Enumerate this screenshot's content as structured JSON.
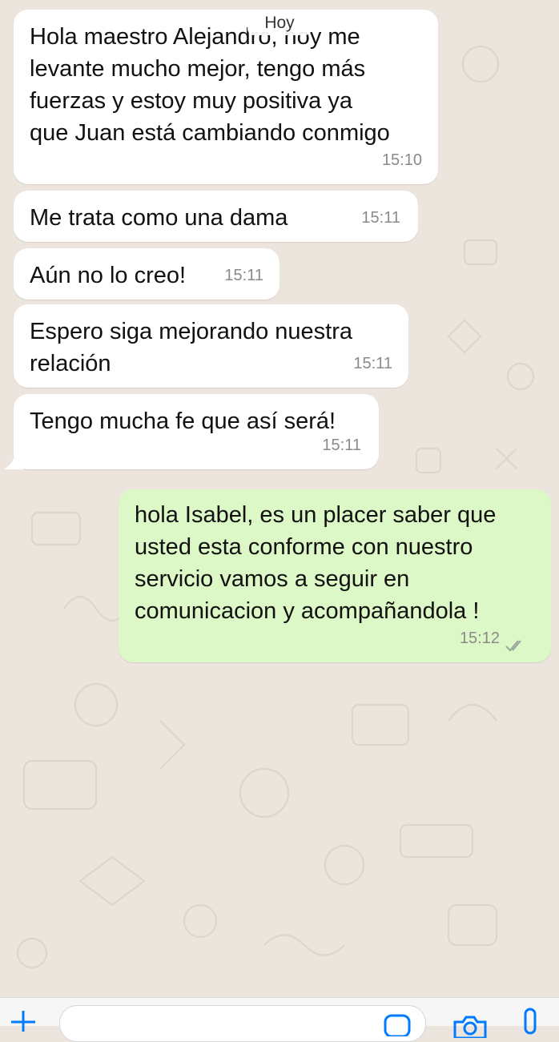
{
  "date_chip": "Hoy",
  "messages": [
    {
      "direction": "incoming",
      "text": "Hola maestro Alejandro, hoy me\nlevante mucho mejor, tengo más\nfuerzas y estoy muy positiva ya\nque Juan está cambiando conmigo",
      "time": "15:10"
    },
    {
      "direction": "incoming",
      "text": "Me trata como una dama",
      "time": "15:11"
    },
    {
      "direction": "incoming",
      "text": "Aún no lo creo!",
      "time": "15:11"
    },
    {
      "direction": "incoming",
      "text": "Espero siga mejorando nuestra\nrelación",
      "time": "15:11"
    },
    {
      "direction": "incoming",
      "text": "Tengo mucha fe que así será!",
      "time": "15:11"
    },
    {
      "direction": "outgoing",
      "text": "hola Isabel, es un placer saber que\nusted esta conforme con nuestro\nservicio vamos a seguir en\ncomunicacion y acompañandola !",
      "time": "15:12",
      "status": "read"
    }
  ],
  "composer": {
    "input_value": "",
    "icons": [
      "plus-icon",
      "sticker-icon",
      "camera-icon",
      "microphone-icon"
    ]
  },
  "colors": {
    "background": "#ECE5DD",
    "incoming_bubble": "#FFFFFF",
    "outgoing_bubble": "#DCF8C6",
    "timestamp": "#8A8A8A",
    "accent": "#007AFF"
  }
}
